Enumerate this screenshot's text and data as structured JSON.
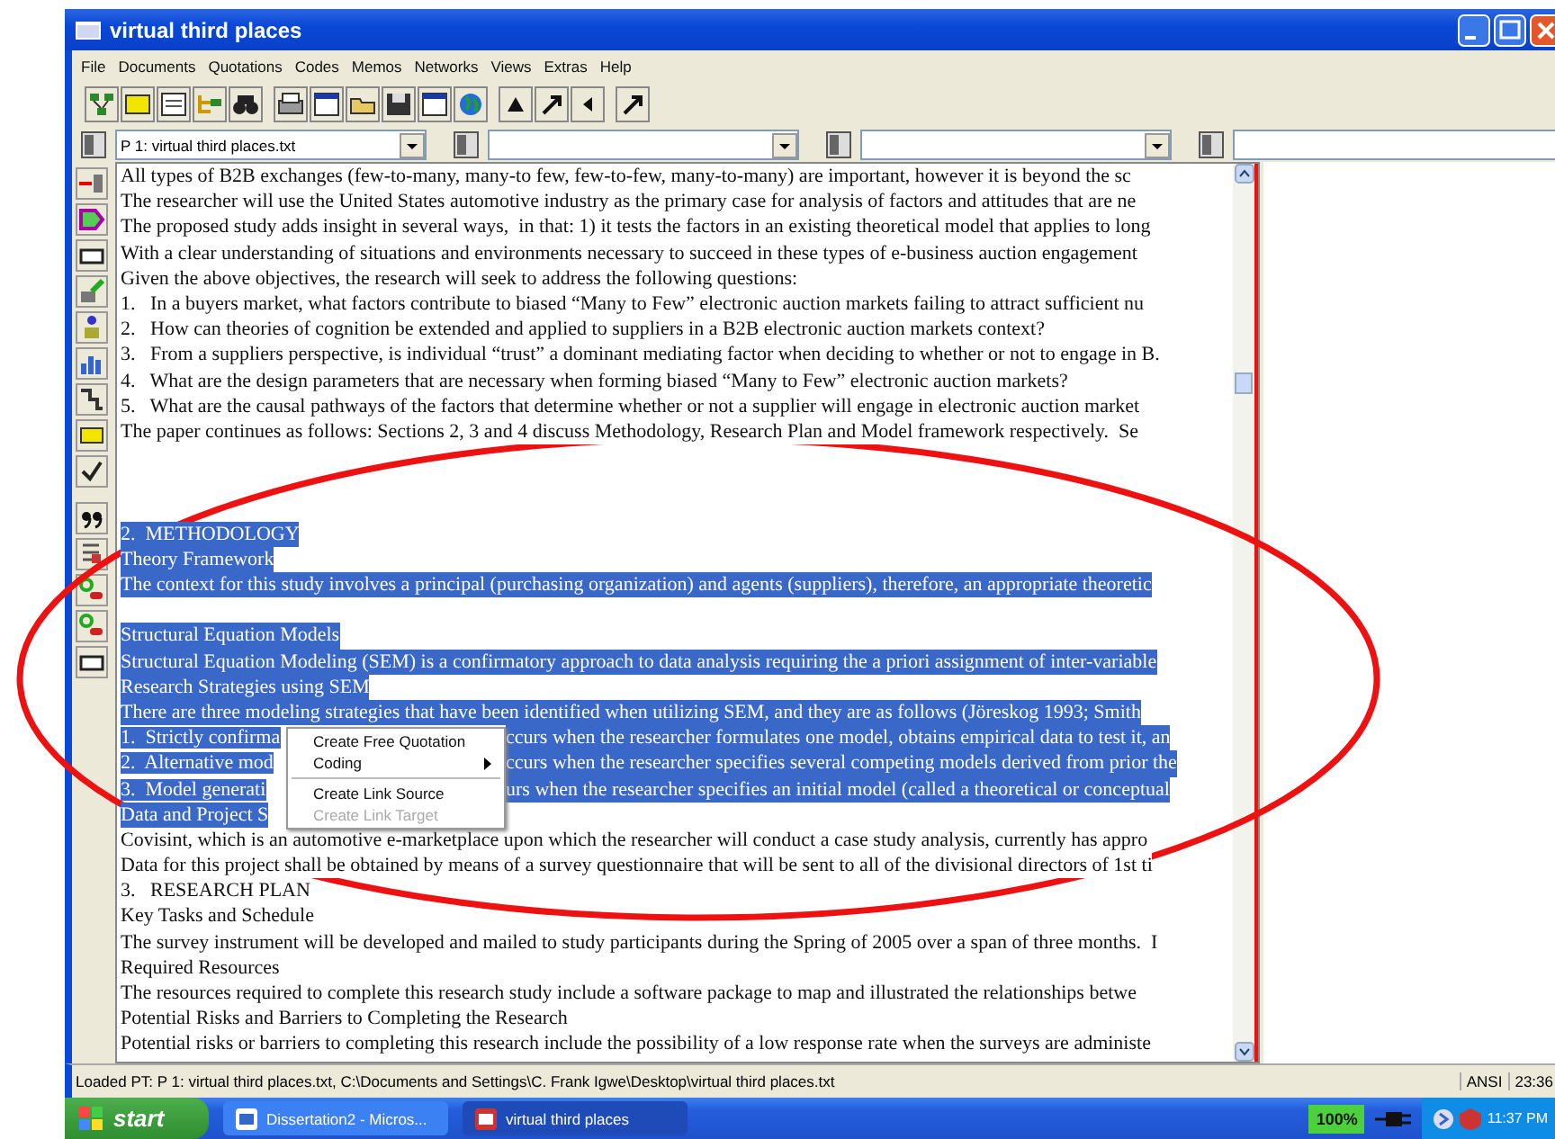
{
  "window": {
    "title": "virtual third places"
  },
  "menu": [
    "File",
    "Documents",
    "Quotations",
    "Codes",
    "Memos",
    "Networks",
    "Views",
    "Extras",
    "Help"
  ],
  "selectors": [
    {
      "kind": "combo",
      "value": "P 1: virtual third places.txt"
    },
    {
      "kind": "combo"
    },
    {
      "kind": "combo"
    },
    {
      "kind": "cut"
    }
  ],
  "document": {
    "lines": [
      {
        "kind": "text",
        "text": "All types of B2B exchanges (few-to-many, many-to few, few-to-few, many-to-many) are important, however it is beyond the sc",
        "selected": false
      },
      {
        "kind": "text",
        "text": "The researcher will use the United States automotive industry as the primary case for analysis of factors and attitudes that are ne",
        "selected": false
      },
      {
        "kind": "text",
        "text": "The proposed study adds insight in several ways,  in that: 1) it tests the factors in an existing theoretical model that applies to long",
        "selected": false
      },
      {
        "kind": "text",
        "text": "With a clear understanding of situations and environments necessary to succeed in these types of e-business auction engagement",
        "selected": false
      },
      {
        "kind": "text",
        "text": "Given the above objectives, the research will seek to address the following questions:",
        "selected": false
      },
      {
        "kind": "text",
        "text": "1.   In a buyers market, what factors contribute to biased “Many to Few” electronic auction markets failing to attract sufficient nu",
        "selected": false
      },
      {
        "kind": "text",
        "text": "2.   How can theories of cognition be extended and applied to suppliers in a B2B electronic auction markets context?",
        "selected": false
      },
      {
        "kind": "text",
        "text": "3.   From a suppliers perspective, is individual “trust” a dominant mediating factor when deciding to whether or not to engage in B.",
        "selected": false
      },
      {
        "kind": "text",
        "text": "4.   What are the design parameters that are necessary when forming biased “Many to Few” electronic auction markets?",
        "selected": false
      },
      {
        "kind": "text",
        "text": "5.   What are the causal pathways of the factors that determine whether or not a supplier will engage in electronic auction market",
        "selected": false
      },
      {
        "kind": "text",
        "text": "The paper continues as follows: Sections 2, 3 and 4 discuss Methodology, Research Plan and Model framework respectively.  Se",
        "selected": false
      },
      {
        "kind": "blank"
      },
      {
        "kind": "blank"
      },
      {
        "kind": "blank"
      },
      {
        "kind": "text",
        "text": "2.  METHODOLOGY",
        "selected": true
      },
      {
        "kind": "text",
        "text": "Theory Framework",
        "selected": true
      },
      {
        "kind": "text",
        "text": "The context for this study involves a principal (purchasing organization) and agents (suppliers), therefore, an appropriate theoretic",
        "selected": true
      },
      {
        "kind": "blank"
      },
      {
        "kind": "text",
        "text": "Structural Equation Models",
        "selected": true
      },
      {
        "kind": "text",
        "text": "Structural Equation Modeling (SEM) is a confirmatory approach to data analysis requiring the a priori assignment of inter-variable",
        "selected": true
      },
      {
        "kind": "text",
        "text": "Research Strategies using SEM",
        "selected": true
      },
      {
        "kind": "text",
        "text": "There are three modeling strategies that have been identified when utilizing SEM, and they are as follows (Jöreskog 1993; Smith",
        "selected": true
      },
      {
        "kind": "split",
        "segments": [
          "1.  Strictly confirma",
          "ccurs when the researcher formulates one model, obtains empirical data to test it, an"
        ],
        "selected": true
      },
      {
        "kind": "split",
        "segments": [
          "2.  Alternative mod",
          "ccurs when the researcher specifies several competing models derived from prior the"
        ],
        "selected": true
      },
      {
        "kind": "split",
        "segments": [
          "3.  Model generati",
          "urs when the researcher specifies an initial model (called a theoretical or conceptual"
        ],
        "selected": true
      },
      {
        "kind": "text",
        "text": "Data and Project S",
        "selected": true
      },
      {
        "kind": "text",
        "text": "Covisint, which is an automotive e-marketplace upon which the researcher will conduct a case study analysis, currently has appro",
        "selected": false
      },
      {
        "kind": "text",
        "text": "Data for this project shall be obtained by means of a survey questionnaire that will be sent to all of the divisional directors of 1st ti",
        "selected": false
      },
      {
        "kind": "text",
        "text": "3.   RESEARCH PLAN",
        "selected": false
      },
      {
        "kind": "text",
        "text": "Key Tasks and Schedule",
        "selected": false
      },
      {
        "kind": "text",
        "text": "The survey instrument will be developed and mailed to study participants during the Spring of 2005 over a span of three months.  I",
        "selected": false
      },
      {
        "kind": "text",
        "text": "Required Resources",
        "selected": false
      },
      {
        "kind": "text",
        "text": "The resources required to complete this research study include a software package to map and illustrated the relationships betwe",
        "selected": false
      },
      {
        "kind": "text",
        "text": "Potential Risks and Barriers to Completing the Research",
        "selected": false
      },
      {
        "kind": "text",
        "text": "Potential risks or barriers to completing this research include the possibility of a low response rate when the surveys are administe",
        "selected": false
      }
    ]
  },
  "context_menu": {
    "items": [
      {
        "kind": "item",
        "label": "Create Free Quotation",
        "submenu": false,
        "disabled": false
      },
      {
        "kind": "item",
        "label": "Coding",
        "submenu": true,
        "disabled": false
      },
      {
        "kind": "separator"
      },
      {
        "kind": "item",
        "label": "Create Link Source",
        "submenu": false,
        "disabled": false
      },
      {
        "kind": "item",
        "label": "Create Link Target",
        "submenu": false,
        "disabled": true
      }
    ]
  },
  "status_bar": {
    "message": "Loaded PT: P 1: virtual third places.txt, C:\\Documents and Settings\\C. Frank Igwe\\Desktop\\virtual third places.txt",
    "encoding": "ANSI",
    "time": "23:36"
  },
  "taskbar": {
    "start": "start",
    "tasks": [
      {
        "label": "Dissertation2 - Micros...",
        "selected": false
      },
      {
        "label": "virtual third places",
        "selected": true
      }
    ],
    "battery": "100%",
    "clock": "11:37 PM"
  },
  "annotation": {
    "kind": "ellipse"
  }
}
